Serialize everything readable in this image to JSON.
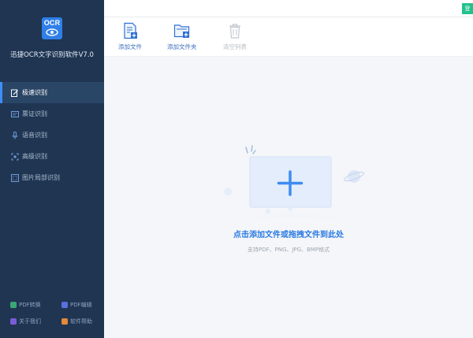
{
  "app": {
    "logo_text": "OCR",
    "title": "迅捷OCR文字识别软件V7.0"
  },
  "sidebar": {
    "items": [
      {
        "label": "极速识别",
        "icon": "quick-recognize-icon",
        "active": true
      },
      {
        "label": "票证识别",
        "icon": "ticket-icon",
        "active": false
      },
      {
        "label": "语音识别",
        "icon": "voice-icon",
        "active": false
      },
      {
        "label": "高级识别",
        "icon": "advanced-icon",
        "active": false
      },
      {
        "label": "图片局部识别",
        "icon": "partial-image-icon",
        "active": false
      }
    ],
    "footer": [
      {
        "label": "PDF转换",
        "icon": "pdf-convert-icon",
        "color": "#3aa876"
      },
      {
        "label": "PDF编辑",
        "icon": "pdf-edit-icon",
        "color": "#5a6fe0"
      },
      {
        "label": "关于我们",
        "icon": "about-icon",
        "color": "#7b5cd6"
      },
      {
        "label": "软件帮助",
        "icon": "help-icon",
        "color": "#e5893a"
      }
    ]
  },
  "topbar": {
    "login_label": "登"
  },
  "toolbar": {
    "add_file": "添加文件",
    "add_folder": "添加文件夹",
    "clear_list": "清空列表"
  },
  "dropzone": {
    "title": "点击添加文件或拖拽文件到此处",
    "subtitle": "支持PDF、PNG、JPG、BMP格式"
  },
  "colors": {
    "sidebar_bg": "#1f3552",
    "accent": "#2a7ae2",
    "login_green": "#23c28c"
  }
}
